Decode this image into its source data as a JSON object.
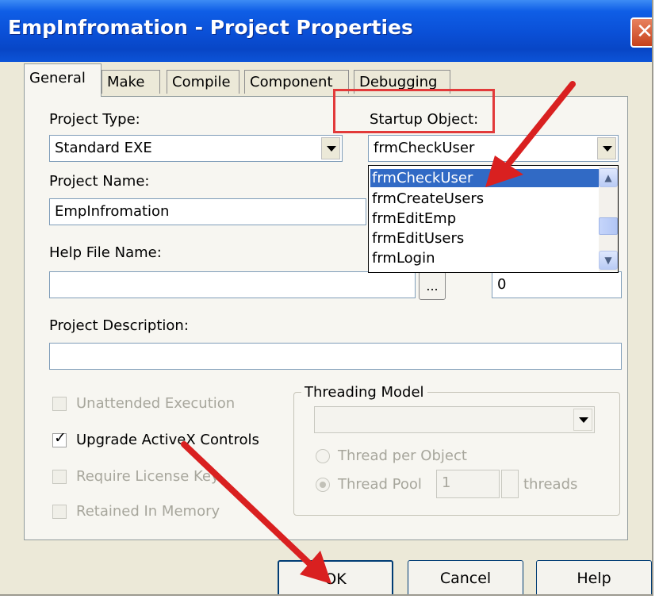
{
  "window": {
    "title": "EmpInfromation - Project Properties",
    "close_glyph": "✕"
  },
  "tabs": [
    {
      "label": "General"
    },
    {
      "label": "Make"
    },
    {
      "label": "Compile"
    },
    {
      "label": "Component"
    },
    {
      "label": "Debugging"
    }
  ],
  "general": {
    "project_type_label": "Project Type:",
    "project_type_value": "Standard EXE",
    "startup_object_label": "Startup Object:",
    "startup_object_value": "frmCheckUser",
    "startup_options": [
      "frmCheckUser",
      "frmCreateUsers",
      "frmEditEmp",
      "frmEditUsers",
      "frmLogin"
    ],
    "project_name_label": "Project Name:",
    "project_name_value": "EmpInfromation",
    "help_file_label": "Help File Name:",
    "help_file_value": "",
    "browse_label": "...",
    "help_context_value": "0",
    "project_description_label": "Project Description:",
    "project_description_value": "",
    "unattended_label": "Unattended Execution",
    "upgrade_activex_label": "Upgrade ActiveX Controls",
    "require_license_label": "Require License Key",
    "retained_memory_label": "Retained In Memory",
    "threading_model_label": "Threading Model",
    "thread_per_object_label": "Thread per Object",
    "thread_pool_label": "Thread Pool",
    "thread_pool_value": "1",
    "threads_label": "threads"
  },
  "buttons": {
    "ok": "OK",
    "cancel": "Cancel",
    "help": "Help"
  },
  "colors": {
    "title_bar": "#0a4fd6",
    "selection": "#316ac5",
    "annotation": "#e23a3a"
  }
}
